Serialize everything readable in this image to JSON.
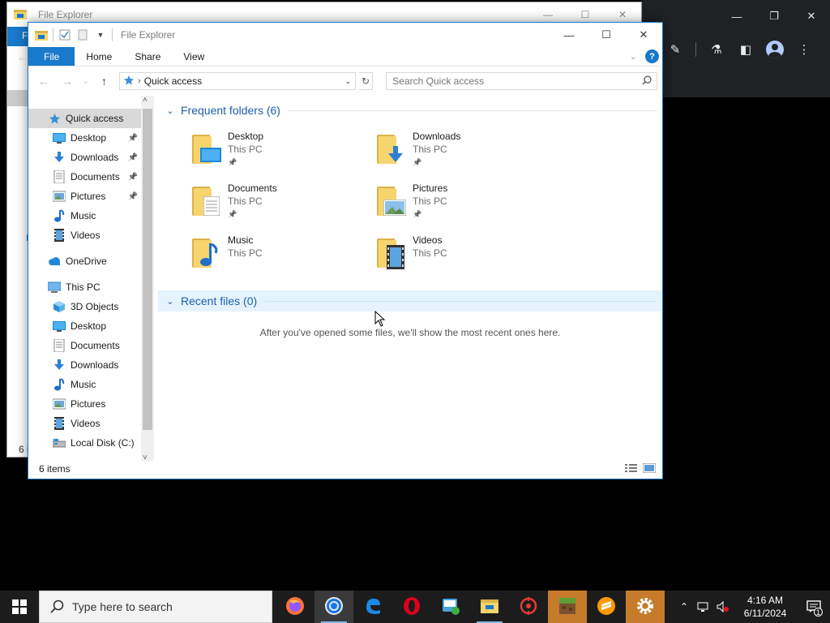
{
  "window": {
    "title": "File Explorer",
    "ribbon_tabs": [
      "File",
      "Home",
      "Share",
      "View"
    ],
    "address": {
      "crumb": "Quick access"
    },
    "search_placeholder": "Search Quick access"
  },
  "background_window": {
    "title": "File Explorer",
    "ribbon_stub": "F",
    "status_stub": "6 i"
  },
  "nav_pane": {
    "items": [
      {
        "label": "Quick access",
        "icon": "quick-access-star-icon",
        "selected": true,
        "pinned": false,
        "indent": 1
      },
      {
        "label": "Desktop",
        "icon": "desktop-icon",
        "pinned": true,
        "indent": 2
      },
      {
        "label": "Downloads",
        "icon": "download-arrow-icon",
        "pinned": true,
        "indent": 2
      },
      {
        "label": "Documents",
        "icon": "document-icon",
        "pinned": true,
        "indent": 2
      },
      {
        "label": "Pictures",
        "icon": "picture-icon",
        "pinned": true,
        "indent": 2
      },
      {
        "label": "Music",
        "icon": "music-note-icon",
        "pinned": false,
        "indent": 2
      },
      {
        "label": "Videos",
        "icon": "film-icon",
        "pinned": false,
        "indent": 2
      },
      {
        "label": "OneDrive",
        "icon": "cloud-icon",
        "pinned": false,
        "indent": 1
      },
      {
        "label": "This PC",
        "icon": "computer-icon",
        "pinned": false,
        "indent": 1
      },
      {
        "label": "3D Objects",
        "icon": "cube-icon",
        "pinned": false,
        "indent": 2
      },
      {
        "label": "Desktop",
        "icon": "desktop-icon",
        "pinned": false,
        "indent": 2
      },
      {
        "label": "Documents",
        "icon": "document-icon",
        "pinned": false,
        "indent": 2
      },
      {
        "label": "Downloads",
        "icon": "download-arrow-icon",
        "pinned": false,
        "indent": 2
      },
      {
        "label": "Music",
        "icon": "music-note-icon",
        "pinned": false,
        "indent": 2
      },
      {
        "label": "Pictures",
        "icon": "picture-icon",
        "pinned": false,
        "indent": 2
      },
      {
        "label": "Videos",
        "icon": "film-icon",
        "pinned": false,
        "indent": 2
      },
      {
        "label": "Local Disk (C:)",
        "icon": "disk-icon",
        "pinned": false,
        "indent": 2
      }
    ]
  },
  "frequent": {
    "title": "Frequent folders (6)",
    "folders": [
      {
        "name": "Desktop",
        "location": "This PC",
        "pinned": true,
        "overlay": "desktop"
      },
      {
        "name": "Downloads",
        "location": "This PC",
        "pinned": true,
        "overlay": "downloads"
      },
      {
        "name": "Documents",
        "location": "This PC",
        "pinned": true,
        "overlay": "documents"
      },
      {
        "name": "Pictures",
        "location": "This PC",
        "pinned": true,
        "overlay": "pictures"
      },
      {
        "name": "Music",
        "location": "This PC",
        "pinned": false,
        "overlay": "music"
      },
      {
        "name": "Videos",
        "location": "This PC",
        "pinned": false,
        "overlay": "videos"
      }
    ]
  },
  "recent": {
    "title": "Recent files (0)",
    "empty_message": "After you've opened some files, we'll show the most recent ones here."
  },
  "status": {
    "items": "6 items"
  },
  "taskbar": {
    "search_placeholder": "Type here to search",
    "apps": [
      "firefox-icon",
      "chrome-icon",
      "edge-legacy-icon",
      "opera-icon",
      "teamviewer-icon",
      "file-explorer-icon",
      "app-red-icon",
      "minecraft-icon",
      "sublime-icon",
      "settings-gear-icon"
    ],
    "time": "4:16 AM",
    "date": "6/11/2024",
    "notifications": "1"
  },
  "colors": {
    "accent": "#1979ca",
    "taskbar": "#1c1c1c",
    "folder": "#f6d56e"
  }
}
